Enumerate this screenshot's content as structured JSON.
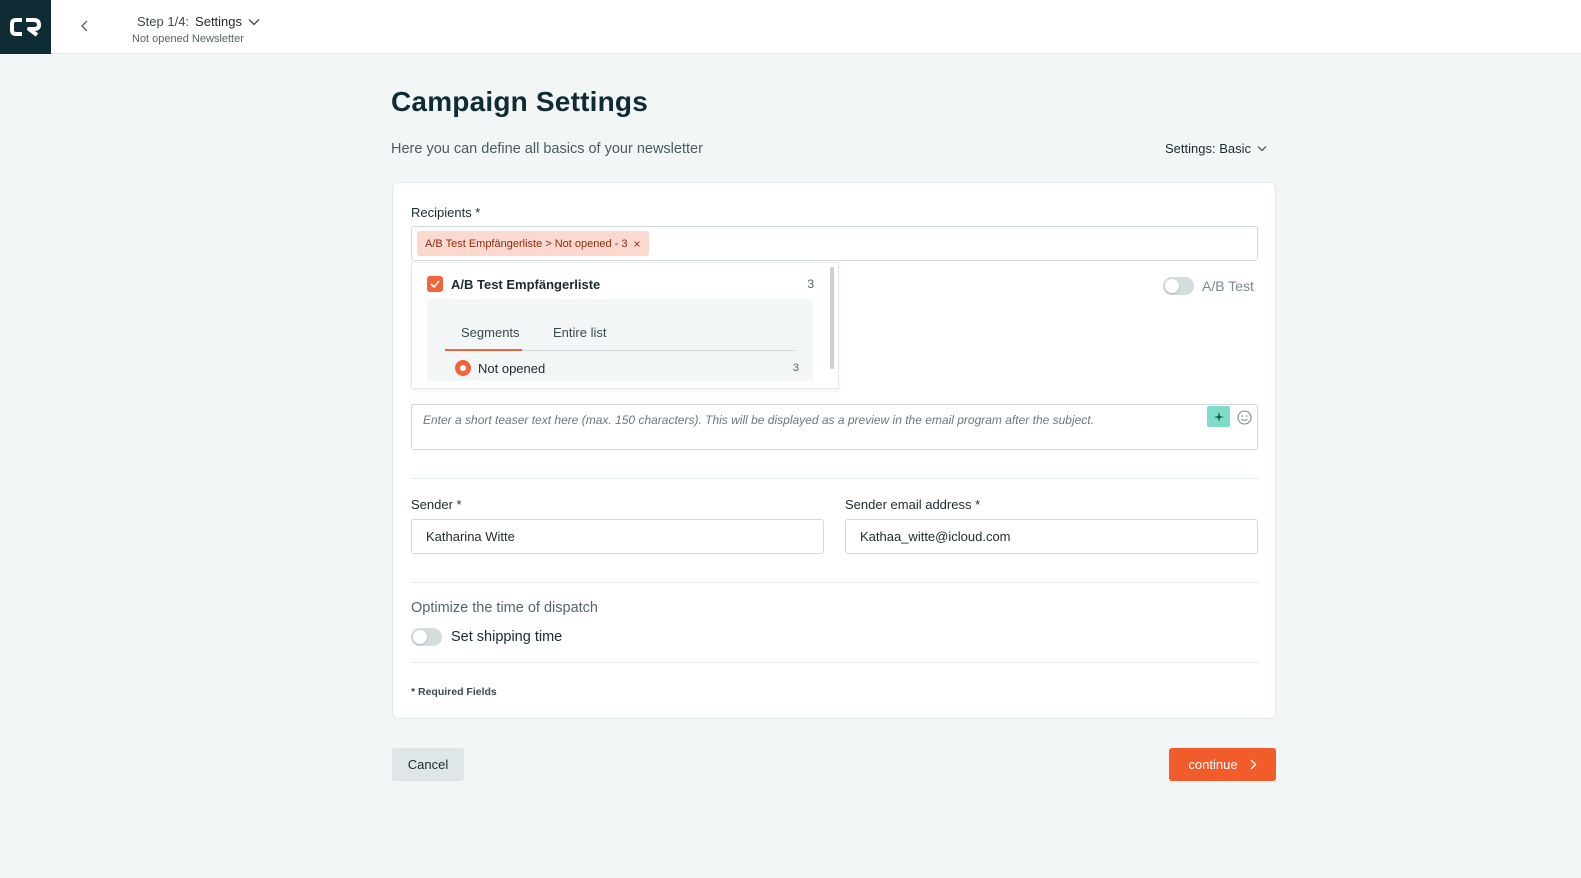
{
  "header": {
    "logo_text": "CR",
    "step_prefix": "Step 1/4:",
    "step_name": "Settings",
    "newsletter_name": "Not opened Newsletter"
  },
  "page": {
    "title": "Campaign Settings",
    "subtitle": "Here you can define all basics of your newsletter",
    "settings_mode": "Settings: Basic"
  },
  "recipients": {
    "label": "Recipients *",
    "chip_text": "A/B Test Empfängerliste > Not opened  -  3",
    "chip_close": "×",
    "list": {
      "name": "A/B Test Empfängerliste",
      "count": "3",
      "checked": true,
      "tabs": [
        "Segments",
        "Entire list"
      ],
      "active_tab": "Segments",
      "segment": {
        "name": "Not opened",
        "count": "3",
        "selected": true
      }
    }
  },
  "ab_test": {
    "label": "A/B Test",
    "enabled": false
  },
  "teaser": {
    "placeholder": "Enter a short teaser text here (max. 150 characters). This will be displayed as a preview in the email program after the subject."
  },
  "sender": {
    "label": "Sender *",
    "value": "Katharina Witte"
  },
  "sender_email": {
    "label": "Sender email address *",
    "value": "Kathaa_witte@icloud.com"
  },
  "dispatch": {
    "title": "Optimize the time of dispatch",
    "toggle_label": "Set shipping time",
    "enabled": false
  },
  "footer_note": "* Required Fields",
  "actions": {
    "cancel": "Cancel",
    "continue": "continue"
  },
  "colors": {
    "brand_dark": "#0f2b33",
    "accent": "#f25b2a",
    "chip_bg": "#fcd8ce",
    "ai_button": "#7fdccb"
  }
}
